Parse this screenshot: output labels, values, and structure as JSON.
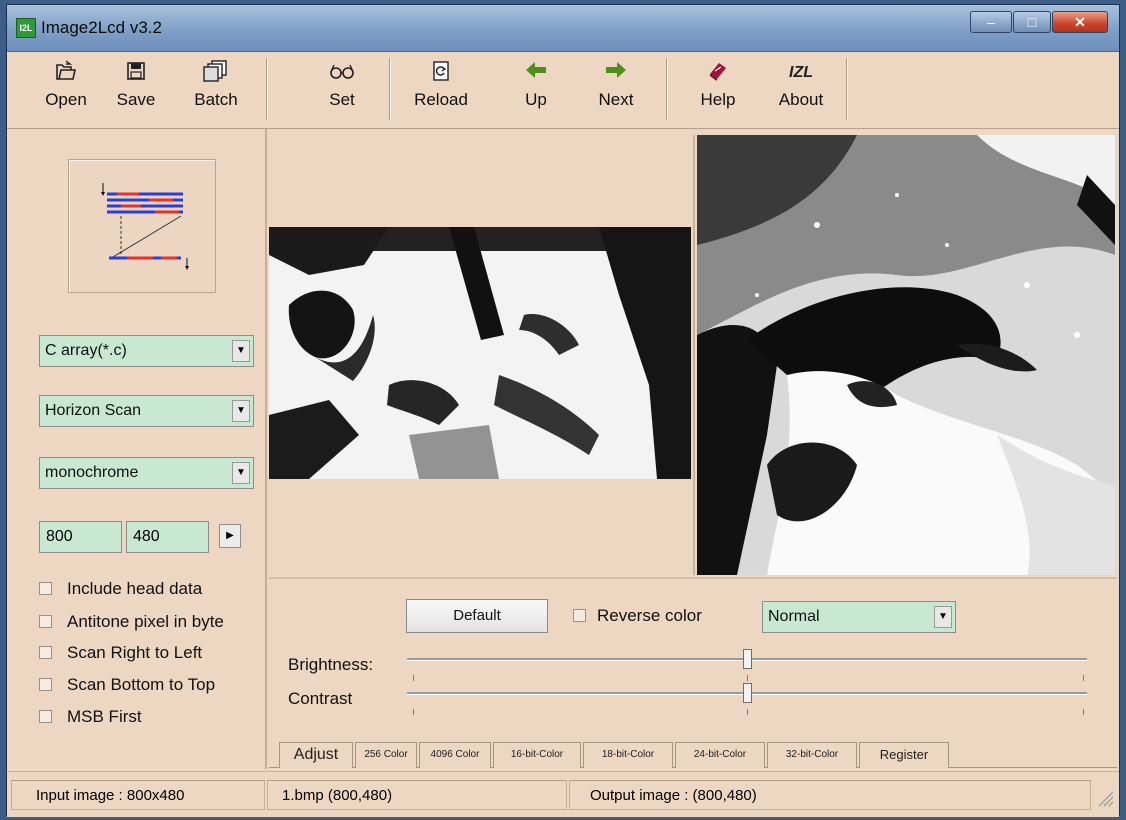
{
  "window": {
    "title": "Image2Lcd v3.2",
    "app_icon_text": "I2L"
  },
  "toolbar": {
    "open": "Open",
    "save": "Save",
    "batch": "Batch",
    "set": "Set",
    "reload": "Reload",
    "up": "Up",
    "next": "Next",
    "help": "Help",
    "about": "About",
    "about_icon_text": "IZL"
  },
  "settings": {
    "output_type": "C array(*.c)",
    "scan_mode": "Horizon Scan",
    "color_depth": "monochrome",
    "width": "800",
    "height": "480",
    "options": [
      {
        "label": "Include head data",
        "checked": false
      },
      {
        "label": "Antitone pixel in byte",
        "checked": false
      },
      {
        "label": "Scan Right to Left",
        "checked": false
      },
      {
        "label": "Scan Bottom to Top",
        "checked": false
      },
      {
        "label": "MSB First",
        "checked": false
      }
    ]
  },
  "adjust": {
    "default_button": "Default",
    "reverse_color": "Reverse color",
    "reverse_color_checked": false,
    "mode": "Normal",
    "brightness_label": "Brightness:",
    "contrast_label": "Contrast",
    "brightness_level": 0.5,
    "contrast_level": 0.5
  },
  "tabs": [
    "Adjust",
    "256 Color",
    "4096 Color",
    "16-bit-Color",
    "18-bit-Color",
    "24-bit-Color",
    "32-bit-Color",
    "Register"
  ],
  "status": {
    "input_image": "Input image :  800x480",
    "file": "1.bmp  (800,480)",
    "output_image": "Output image :  (800,480)"
  }
}
